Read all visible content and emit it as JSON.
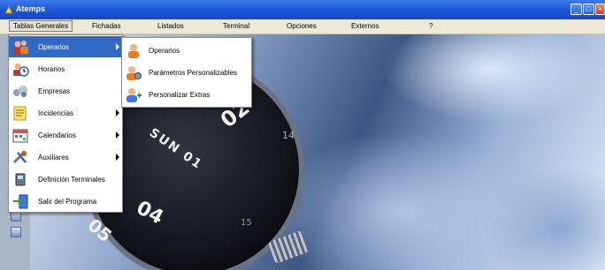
{
  "window": {
    "title": "Atemps"
  },
  "menubar": [
    {
      "label": "Tablas Generales"
    },
    {
      "label": "Fichadas"
    },
    {
      "label": "Listados"
    },
    {
      "label": "Terminal"
    },
    {
      "label": "Opciones"
    },
    {
      "label": "Externos"
    },
    {
      "label": "?"
    }
  ],
  "main_menu": [
    {
      "label": "Operarios",
      "icon": "users-icon",
      "submenu": true,
      "highlighted": true
    },
    {
      "label": "Horarios",
      "icon": "clock-user-icon",
      "submenu": false
    },
    {
      "label": "Empresas",
      "icon": "company-icon",
      "submenu": false
    },
    {
      "label": "Incidencias",
      "icon": "notes-icon",
      "submenu": true
    },
    {
      "label": "Calendarios",
      "icon": "calendar-icon",
      "submenu": true
    },
    {
      "label": "Auxiliares",
      "icon": "tools-icon",
      "submenu": true
    },
    {
      "label": "Definición Terminales",
      "icon": "terminal-icon",
      "submenu": false
    },
    {
      "label": "Salir del Programa",
      "icon": "exit-icon",
      "submenu": false
    }
  ],
  "sub_menu": [
    {
      "label": "Operarios",
      "icon": "user-icon"
    },
    {
      "label": "Parámetros Personalizables",
      "icon": "user-settings-icon"
    },
    {
      "label": "Personalizar Extras",
      "icon": "user-extras-icon"
    }
  ],
  "backdrop": {
    "watch_labels": {
      "a": "02",
      "b": "14",
      "c": "SUN 01",
      "d": "04",
      "e": "05",
      "f": "15"
    }
  },
  "colors": {
    "titlebar": "#1a55d6",
    "menu_highlight": "#316ac5",
    "menubar": "#ece9d8"
  }
}
